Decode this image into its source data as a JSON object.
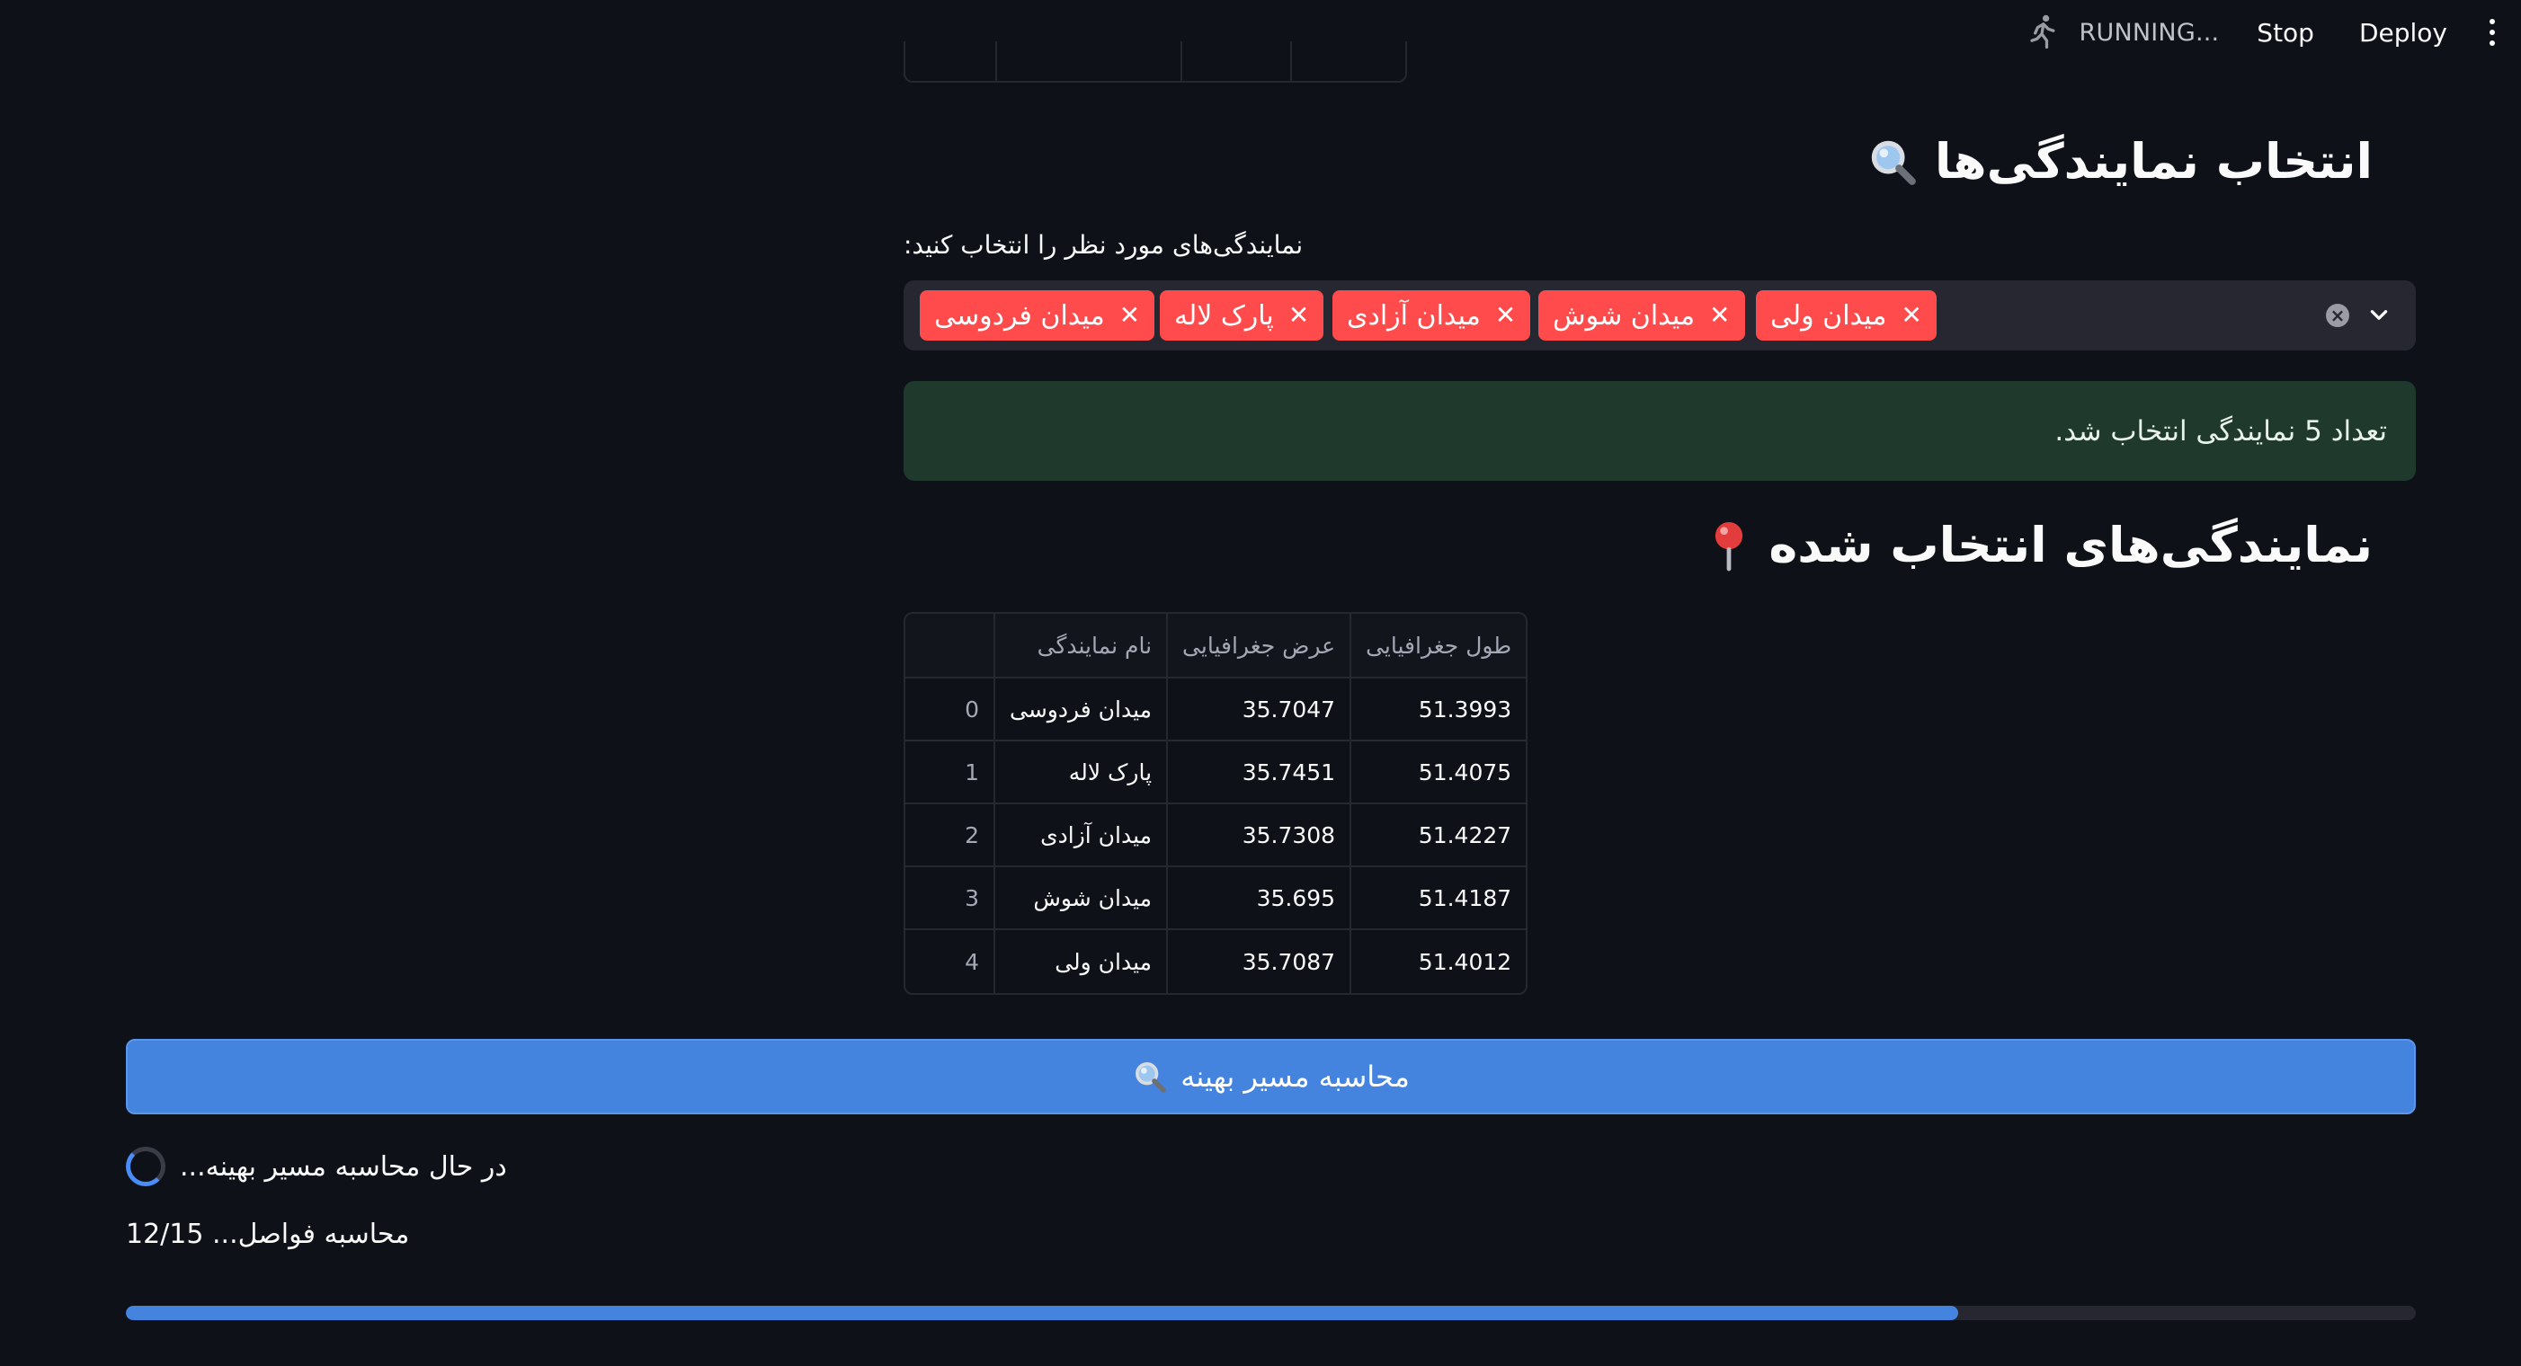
{
  "toolbar": {
    "status": "RUNNING...",
    "stop_label": "Stop",
    "deploy_label": "Deploy"
  },
  "section_select": {
    "title": "انتخاب نمایندگی‌ها",
    "title_icon": "magnifier-icon",
    "label": "نمایندگی‌های مورد نظر را انتخاب کنید:",
    "chips": [
      "میدان ولی",
      "میدان شوش",
      "میدان آزادی",
      "پارک لاله",
      "میدان فردوسی"
    ],
    "chip_color": "#ff4b4b"
  },
  "success_message": "تعداد 5 نمایندگی انتخاب شد.",
  "section_selected": {
    "title": "نمایندگی‌های انتخاب شده",
    "title_icon": "pushpin-icon"
  },
  "table": {
    "headers": [
      "",
      "نام نمایندگی",
      "عرض جغرافیایی",
      "طول جغرافیایی"
    ],
    "rows": [
      {
        "index": "0",
        "name": "میدان فردوسی",
        "lat": "35.7047",
        "lon": "51.3993"
      },
      {
        "index": "1",
        "name": "پارک لاله",
        "lat": "35.7451",
        "lon": "51.4075"
      },
      {
        "index": "2",
        "name": "میدان آزادی",
        "lat": "35.7308",
        "lon": "51.4227"
      },
      {
        "index": "3",
        "name": "میدان شوش",
        "lat": "35.695",
        "lon": "51.4187"
      },
      {
        "index": "4",
        "name": "میدان ولی",
        "lat": "35.7087",
        "lon": "51.4012"
      }
    ]
  },
  "calculate_button": "محاسبه مسیر بهینه",
  "spinner_text": "در حال محاسبه مسیر بهینه...",
  "progress": {
    "text": "محاسبه فواصل... 12/15",
    "fraction": 0.8
  },
  "colors": {
    "background": "#0e1117",
    "primary_button": "#4484df",
    "success_bg": "#1f3a2c"
  }
}
